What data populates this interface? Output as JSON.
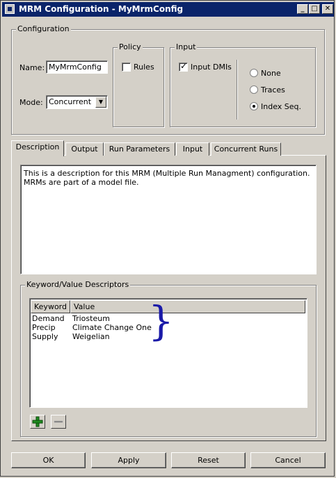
{
  "window": {
    "title": "MRM Configuration - MyMrmConfig",
    "minimize_label": "_",
    "maximize_label": "□",
    "close_label": "✕"
  },
  "configuration": {
    "group_label": "Configuration",
    "name_label": "Name:",
    "name_value": "MyMrmConfig",
    "mode_label": "Mode:",
    "mode_value": "Concurrent"
  },
  "policy": {
    "group_label": "Policy",
    "rules_label": "Rules",
    "rules_checked": false
  },
  "input": {
    "group_label": "Input",
    "input_dmis_label": "Input DMIs",
    "input_dmis_checked": true,
    "options": [
      "None",
      "Traces",
      "Index Seq."
    ],
    "selected": "Index Seq."
  },
  "tabs": [
    "Description",
    "Output",
    "Run Parameters",
    "Input",
    "Concurrent Runs"
  ],
  "active_tab": "Description",
  "description": "This is a description for this MRM (Multiple Run Managment) configuration.  MRMs are part of a model file.",
  "descriptors": {
    "group_label": "Keyword/Value Descriptors",
    "columns": [
      "Keyword",
      "Value"
    ],
    "rows": [
      {
        "keyword": "Demand",
        "value": "Triosteum"
      },
      {
        "keyword": "Precip",
        "value": "Climate Change One"
      },
      {
        "keyword": "Supply",
        "value": "Weigelian"
      }
    ],
    "annotation_brace": "}",
    "annotation_color": "#1a1aa8"
  },
  "buttons": {
    "ok": "OK",
    "apply": "Apply",
    "reset": "Reset",
    "cancel": "Cancel"
  }
}
